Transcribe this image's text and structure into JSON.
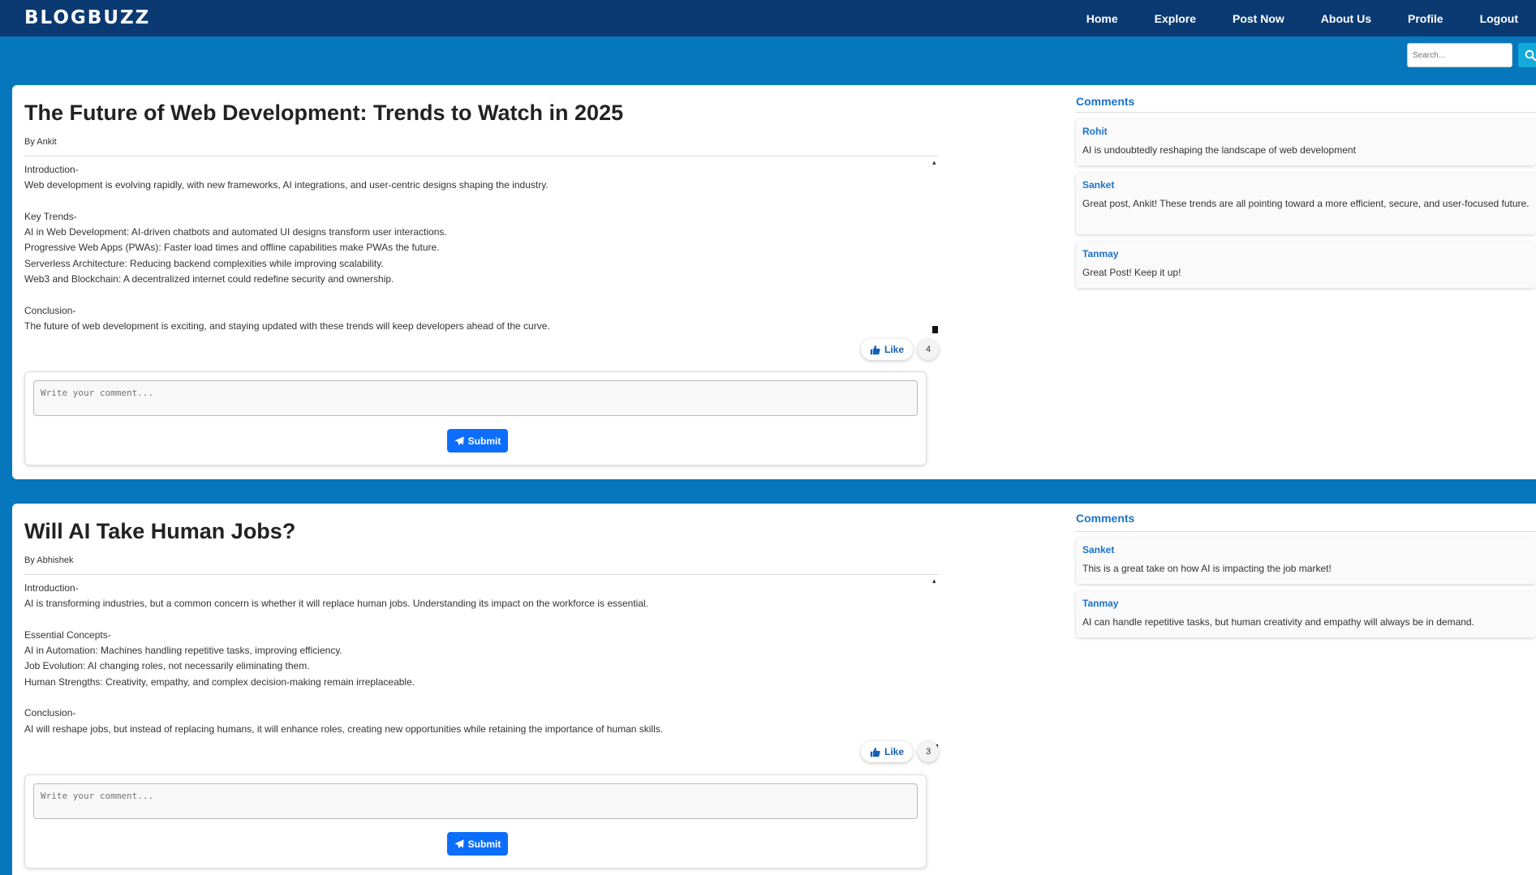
{
  "brand": "BLOGBUZZ",
  "nav": [
    "Home",
    "Explore",
    "Post Now",
    "About Us",
    "Profile",
    "Logout"
  ],
  "search": {
    "placeholder": "Search..."
  },
  "colors": {
    "header": "#0b3a73",
    "page": "#0777bd",
    "accent": "#0d6efd",
    "link": "#1a73c9"
  },
  "posts": [
    {
      "title": "The Future of Web Development: Trends to Watch in 2025",
      "author": "By Ankit",
      "body": "Introduction-\nWeb development is evolving rapidly, with new frameworks, AI integrations, and user-centric designs shaping the industry.\n\nKey Trends-\nAI in Web Development: AI-driven chatbots and automated UI designs transform user interactions.\nProgressive Web Apps (PWAs): Faster load times and offline capabilities make PWAs the future.\nServerless Architecture: Reducing backend complexities while improving scalability.\nWeb3 and Blockchain: A decentralized internet could redefine security and ownership.\n\nConclusion-\nThe future of web development is exciting, and staying updated with these trends will keep developers ahead of the curve.",
      "like_label": "Like",
      "likes": "4",
      "comment_placeholder": "Write your comment...",
      "submit_label": "Submit",
      "comments_heading": "Comments",
      "comments": [
        {
          "user": "Rohit",
          "text": "AI is undoubtedly reshaping the landscape of web development"
        },
        {
          "user": "Sanket",
          "text": "Great post, Ankit! These trends are all pointing toward a more efficient, secure, and user-focused future."
        },
        {
          "user": "Tanmay",
          "text": "Great Post! Keep it up!"
        }
      ]
    },
    {
      "title": "Will AI Take Human Jobs?",
      "author": "By Abhishek",
      "body": "Introduction-\nAI is transforming industries, but a common concern is whether it will replace human jobs. Understanding its impact on the workforce is essential.\n\nEssential Concepts-\nAI in Automation: Machines handling repetitive tasks, improving efficiency.\nJob Evolution: AI changing roles, not necessarily eliminating them.\nHuman Strengths: Creativity, empathy, and complex decision-making remain irreplaceable.\n\nConclusion-\nAI will reshape jobs, but instead of replacing humans, it will enhance roles, creating new opportunities while retaining the importance of human skills.",
      "like_label": "Like",
      "likes": "3",
      "comment_placeholder": "Write your comment...",
      "submit_label": "Submit",
      "comments_heading": "Comments",
      "comments": [
        {
          "user": "Sanket",
          "text": "This is a great take on how AI is impacting the job market!"
        },
        {
          "user": "Tanmay",
          "text": "AI can handle repetitive tasks, but human creativity and empathy will always be in demand."
        }
      ]
    }
  ]
}
